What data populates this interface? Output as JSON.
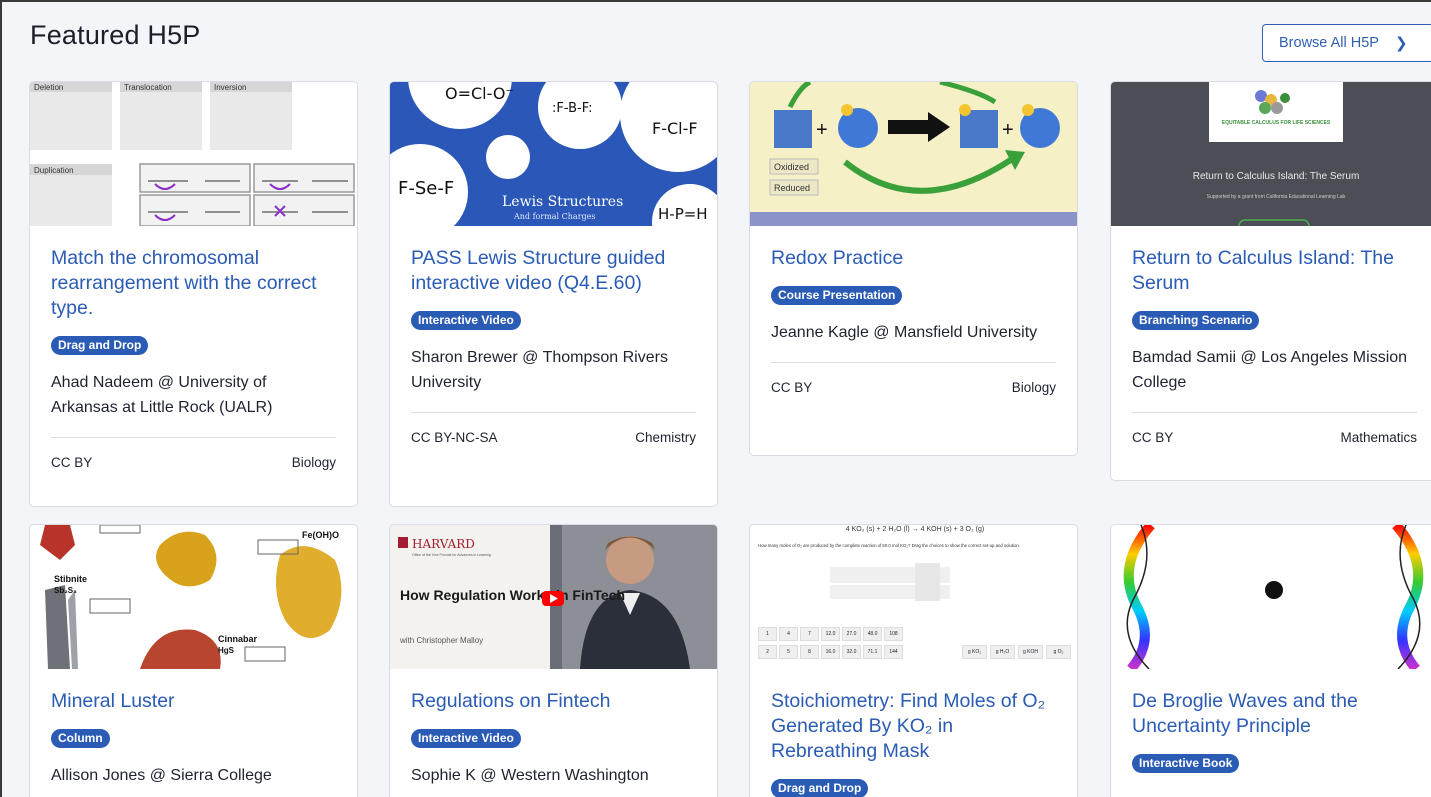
{
  "header": {
    "title": "Featured H5P",
    "browse_label": "Browse All H5P",
    "browse_icon": "chevron-right-icon"
  },
  "cards": [
    {
      "title": "Match the chromosomal rearrangement with the correct type.",
      "badge": "Drag and Drop",
      "author": "Ahad Nadeem @ University of Arkansas at Little Rock (UALR)",
      "license": "CC BY",
      "subject": "Biology",
      "thumb": {
        "labels": [
          "Deletion",
          "Translocation",
          "Inversion",
          "Duplication"
        ]
      }
    },
    {
      "title": "PASS Lewis Structure guided interactive video (Q4.E.60)",
      "badge": "Interactive Video",
      "author": "Sharon Brewer @ Thompson Rivers University",
      "license": "CC BY-NC-SA",
      "subject": "Chemistry",
      "thumb": {
        "heading": "Lewis Structures",
        "subheading": "And formal Charges",
        "formulas": [
          "O=Cl-O⁻",
          ":F-B-F:",
          "F-Cl-F",
          "F-Se-F",
          "H-P=H"
        ]
      }
    },
    {
      "title": "Redox Practice",
      "badge": "Course Presentation",
      "author": "Jeanne Kagle @ Mansfield University",
      "license": "CC BY",
      "subject": "Biology",
      "thumb": {
        "labels": [
          "Oxidized",
          "Reduced"
        ]
      }
    },
    {
      "title": "Return to Calculus Island: The Serum",
      "badge": "Branching Scenario",
      "author": "Bamdad Samii @ Los Angeles Mission College",
      "license": "CC BY",
      "subject": "Mathematics",
      "thumb": {
        "heading": "Return to Calculus Island: The Serum",
        "logo_text": "EQUITABLE CALCULUS FOR LIFE SCIENCES",
        "note": "Supported by a grant from California Educational Learning Lab"
      }
    },
    {
      "title": "Mineral Luster",
      "badge": "Column",
      "author": "Allison Jones @ Sierra College",
      "license": "",
      "subject": "",
      "thumb": {
        "labels": [
          "Stibnite",
          "Sb₂S₃",
          "Fe(OH)O",
          "Cinnabar",
          "HgS"
        ]
      }
    },
    {
      "title": "Regulations on Fintech",
      "badge": "Interactive Video",
      "author": "Sophie K @ Western Washington",
      "license": "",
      "subject": "",
      "thumb": {
        "brand": "HARVARD",
        "brand_sub": "Office of the Vice Provost for Advances in Learning",
        "heading": "How Regulation Works in FinTech",
        "byline": "with Christopher Malloy"
      }
    },
    {
      "title": "Stoichiometry: Find Moles of O₂ Generated By KO₂ in Rebreathing Mask",
      "badge": "Drag and Drop",
      "author": "",
      "license": "",
      "subject": "",
      "thumb": {
        "equation": "4 KO₂ (s) + 2 H₂O (l) → 4 KOH (s) + 3 O₂ (g)",
        "question": "How many moles of O₂ are produced by the complete reaction of 50.0 mol KO₂? Drag the choices to show the correct set-up and solution.",
        "row1": [
          "1",
          "4",
          "7",
          "12.0",
          "27.0",
          "48.0",
          "108"
        ],
        "row2": [
          "2",
          "5",
          "8",
          "16.0",
          "32.0",
          "71.1",
          "144"
        ],
        "units": [
          "g KO₂",
          "g H₂O",
          "g KOH",
          "g O₂"
        ]
      }
    },
    {
      "title": "De Broglie Waves and the Uncertainty Principle",
      "badge": "Interactive Book",
      "author": "",
      "license": "",
      "subject": "",
      "thumb": {}
    }
  ],
  "colors": {
    "accent": "#2a5bb5",
    "background": "#f4f5f8",
    "card_border": "#d9dce3"
  }
}
